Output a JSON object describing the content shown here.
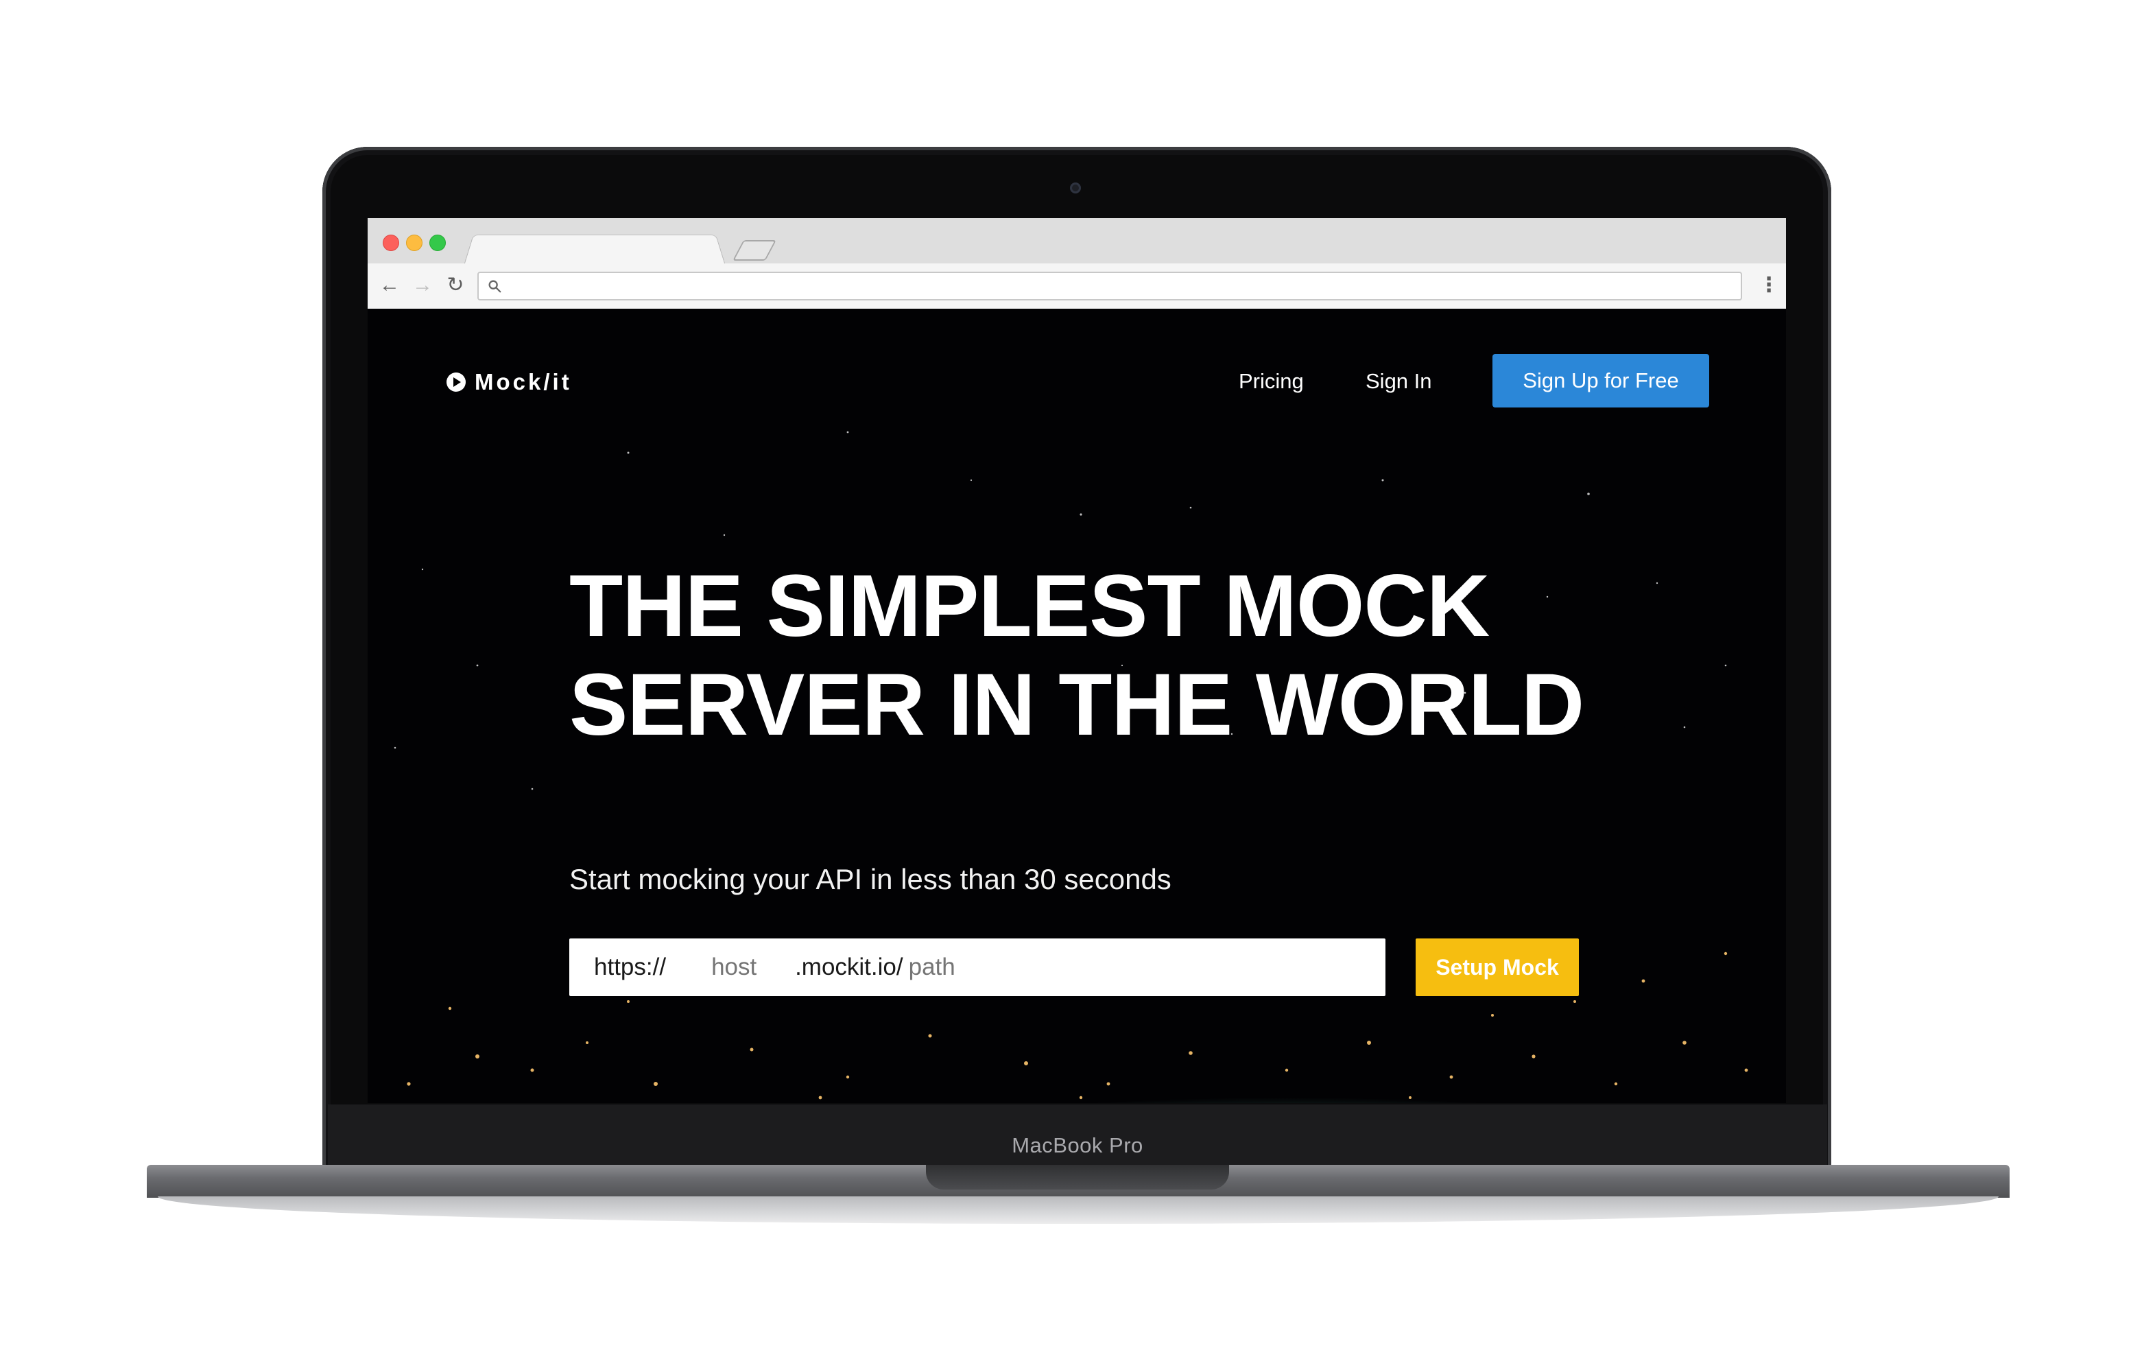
{
  "device": {
    "label": "MacBook Pro"
  },
  "browser": {
    "url": "",
    "icons": {
      "back": "arrow-left-icon",
      "forward": "arrow-right-icon",
      "reload": "reload-icon",
      "search": "search-icon",
      "menu": "kebab-menu-icon"
    }
  },
  "site": {
    "logo": "Mock/it",
    "nav": {
      "pricing": "Pricing",
      "sign_in": "Sign In",
      "sign_up": "Sign Up for Free"
    },
    "hero": {
      "title": "THE SIMPLEST MOCK SERVER IN THE WORLD",
      "subtitle": "Start mocking your API in less than 30 seconds"
    },
    "url_builder": {
      "prefix": "https://",
      "host_placeholder": "host",
      "domain": ".mockit.io/",
      "path_placeholder": "path",
      "button": "Setup Mock"
    }
  },
  "colors": {
    "primary_button": "#2b87d8",
    "accent_button": "#f6be10",
    "background": "#020204"
  }
}
